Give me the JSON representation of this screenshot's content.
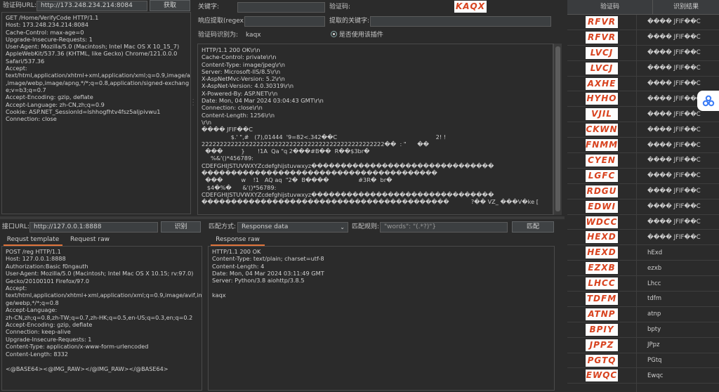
{
  "top_left": {
    "url_label": "验证码URL:",
    "url_value": "http://173.248.234.214:8084",
    "fetch_button": "获取",
    "request_lines": [
      "GET /Home/VerifyCode HTTP/1.1",
      "Host: 173.248.234.214:8084",
      "Cache-Control: max-age=0",
      "Upgrade-Insecure-Requests: 1",
      "User-Agent: Mozilla/5.0 (Macintosh; Intel Mac OS X 10_15_7)",
      "AppleWebKit/537.36 (KHTML, like Gecko) Chrome/121.0.0.0",
      "Safari/537.36",
      "Accept:",
      "text/html,application/xhtml+xml,application/xml;q=0.9,image/avif",
      ",image/webp,image/apng,*/*;q=0.8,application/signed-exchang",
      "e;v=b3;q=0.7",
      "Accept-Encoding: gzip, deflate",
      "Accept-Language: zh-CN,zh;q=0.9",
      "Cookie: ASP.NET_SessionId=lshhogfhtv4fsz5aljpivwu1",
      "Connection: close"
    ]
  },
  "top_middle": {
    "keyword_label": "关键字:",
    "captcha_label": "验证码:",
    "captcha_value": "KAQX",
    "regex_label": "响应提取(regex):",
    "extracted_label": "提取的关键字:",
    "recognized_label": "验证码识别为:",
    "recognized_value": "kaqx",
    "plugin_radio_label": "是否使用该插件",
    "response_lines": [
      "HTTP/1.1 200 OK\\r\\n",
      "Cache-Control: private\\r\\n",
      "Content-Type: image/jpeg\\r\\n",
      "Server: Microsoft-IIS/8.5\\r\\n",
      "X-AspNetMvc-Version: 5.2\\r\\n",
      "X-AspNet-Version: 4.0.30319\\r\\n",
      "X-Powered-By: ASP.NET\\r\\n",
      "Date: Mon, 04 Mar 2024 03:04:43 GMT\\r\\n",
      "Connection: close\\r\\n",
      "Content-Length: 1256\\r\\n",
      "\\r\\n",
      "���� JFIF��C",
      "                $.' \",#   (7),01444  '9=82<.342��C                                                      2! !",
      "22222222222222222222222222222222222222222222222222��  : \"      ��",
      "  ���          }       !1A  Qa \"q 2���#B��  R��$3br�",
      "     %&'()*456789:",
      "CDEFGHIJSTUVWXYZcdefghijstuvwxyz�������������������������������",
      "����������������������������������������",
      "  ���          w    !1   AQ aq  \"2�  B����                #3R�  br�",
      "   $4�%�      &'()*56789:",
      "CDEFGHIJSTUVWXYZcdefghijstuvwxyz�������������������������������",
      "������������������������������������������            ?�� VZ_ ���V�ke ["
    ]
  },
  "bottom_left": {
    "url_label": "接口URL:",
    "url_value": "http://127.0.0.1:8888",
    "recognize_button": "识别",
    "tabs": [
      "Requst template",
      "Request raw"
    ],
    "request_lines": [
      "POST /reg HTTP/1.1",
      "Host: 127.0.0.1:8888",
      "Authorization:Basic f0ngauth",
      "User-Agent: Mozilla/5.0 (Macintosh; Intel Mac OS X 10.15; rv:97.0)",
      "Gecko/20100101 Firefox/97.0",
      "Accept:",
      "text/html,application/xhtml+xml,application/xml;q=0.9,image/avif,ima",
      "ge/webp,*/*;q=0.8",
      "Accept-Language:",
      "zh-CN,zh;q=0.8,zh-TW;q=0.7,zh-HK;q=0.5,en-US;q=0.3,en;q=0.2",
      "Accept-Encoding: gzip, deflate",
      "Connection: keep-alive",
      "Upgrade-Insecure-Requests: 1",
      "Content-Type: application/x-www-form-urlencoded",
      "Content-Length: 8332",
      "",
      "<@BASE64><@IMG_RAW></@IMG_RAW></@BASE64>"
    ]
  },
  "bottom_middle": {
    "match_mode_label": "匹配方式:",
    "match_mode_value": "Response data",
    "match_rule_label": "匹配规则:",
    "match_rule_value": "\"words\": \"(.*?)\"}",
    "match_button": "匹配",
    "tab": "Response raw",
    "response_lines": [
      "HTTP/1.1 200 OK",
      "Content-Type: text/plain; charset=utf-8",
      "Content-Length: 4",
      "Date: Mon, 04 Mar 2024 03:11:49 GMT",
      "Server: Python/3.8 aiohttp/3.8.5",
      "",
      "kaqx"
    ]
  },
  "results_table": {
    "col_captcha": "验证码",
    "col_result": "识别结果",
    "rows": [
      {
        "captcha": "RFVR",
        "result": "���� JFIF��C"
      },
      {
        "captcha": "RFVR",
        "result": "���� JFIF��C"
      },
      {
        "captcha": "LVCJ",
        "result": "���� JFIF��C"
      },
      {
        "captcha": "LVCJ",
        "result": "���� JFIF��C"
      },
      {
        "captcha": "AXHE",
        "result": "���� JFIF��C"
      },
      {
        "captcha": "HYHO",
        "result": "���� JFIF��C"
      },
      {
        "captcha": "VJIL",
        "result": "���� JFIF��C"
      },
      {
        "captcha": "CKWN",
        "result": "���� JFIF��C"
      },
      {
        "captcha": "FNMM",
        "result": "���� JFIF��C"
      },
      {
        "captcha": "CYEN",
        "result": "���� JFIF��C"
      },
      {
        "captcha": "LGFC",
        "result": "���� JFIF��C"
      },
      {
        "captcha": "RDGU",
        "result": "���� JFIF��C"
      },
      {
        "captcha": "EDWI",
        "result": "���� JFIF��C"
      },
      {
        "captcha": "WDCC",
        "result": "���� JFIF��C"
      },
      {
        "captcha": "HEXD",
        "result": "���� JFIF��C"
      },
      {
        "captcha": "HEXD",
        "result": "hExd"
      },
      {
        "captcha": "EZXB",
        "result": "ezxb"
      },
      {
        "captcha": "LHCC",
        "result": "Lhcc"
      },
      {
        "captcha": "TDFM",
        "result": "tdfm"
      },
      {
        "captcha": "ATNP",
        "result": "atnp"
      },
      {
        "captcha": "BPIY",
        "result": "bpty"
      },
      {
        "captcha": "JPPZ",
        "result": "JPpz"
      },
      {
        "captcha": "PGTQ",
        "result": "PGtq"
      },
      {
        "captcha": "EWQC",
        "result": "Ewqc"
      }
    ]
  },
  "colors": {
    "captcha_text": "#d8421e",
    "accent_tab": "#e0743b"
  },
  "icons": {
    "floating_button": "translate-icon"
  }
}
